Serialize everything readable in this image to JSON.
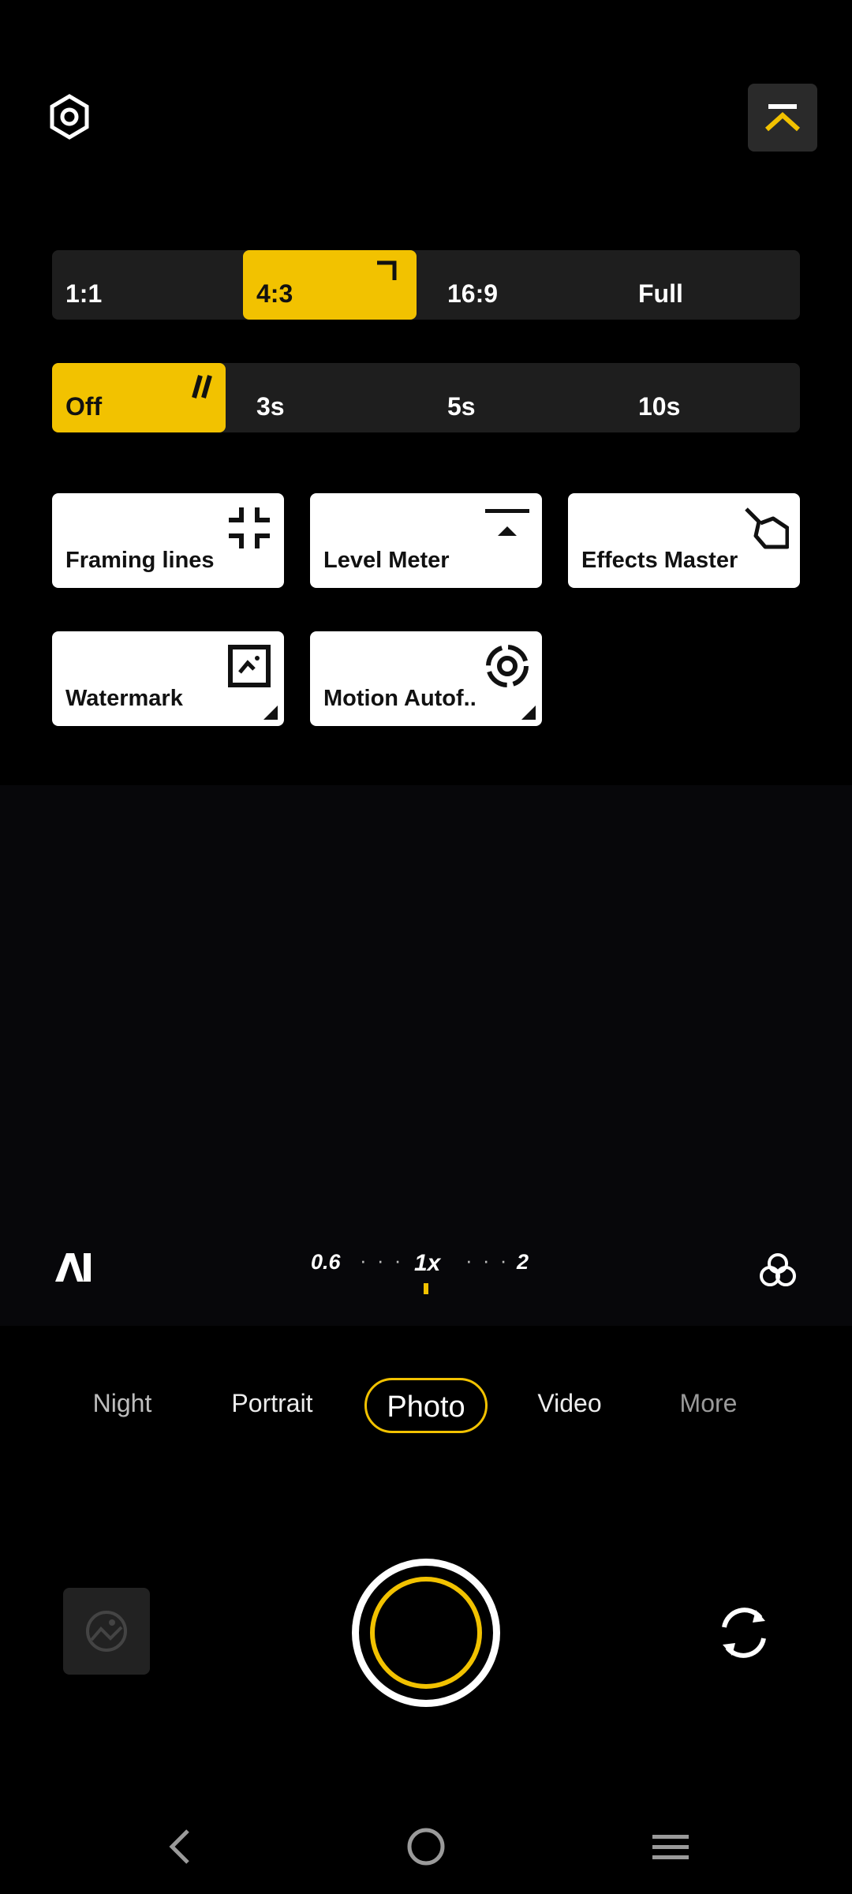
{
  "top_bar": {
    "settings_icon": "hexagon-gear-icon",
    "collapse_icon": "chevron-up-icon",
    "accent_color": "#f2c200"
  },
  "aspect_ratio": {
    "options": [
      "1:1",
      "4:3",
      "16:9",
      "Full"
    ],
    "selected": "4:3"
  },
  "timer": {
    "options": [
      "Off",
      "3s",
      "5s",
      "10s"
    ],
    "selected": "Off"
  },
  "tiles": [
    {
      "label": "Framing lines",
      "icon": "framing-lines-icon"
    },
    {
      "label": "Level Meter",
      "icon": "level-meter-icon"
    },
    {
      "label": "Effects Master",
      "icon": "effects-master-icon"
    },
    {
      "label": "Watermark",
      "icon": "watermark-icon"
    },
    {
      "label": "Motion Autof..",
      "icon": "motion-autofocus-icon"
    }
  ],
  "zoom": {
    "ai_label": "AI",
    "levels": [
      "0.6",
      "1x",
      "2"
    ],
    "dots": "· · ·",
    "selected": "1x"
  },
  "modes": {
    "items": [
      "Night",
      "Portrait",
      "Photo",
      "Video",
      "More"
    ],
    "selected": "Photo"
  },
  "bottom": {
    "gallery_icon": "gallery-placeholder-icon",
    "shutter_icon": "shutter-button",
    "switch_icon": "switch-camera-icon"
  },
  "nav_bar": {
    "back_icon": "back-icon",
    "home_icon": "home-icon",
    "menu_icon": "menu-icon"
  }
}
